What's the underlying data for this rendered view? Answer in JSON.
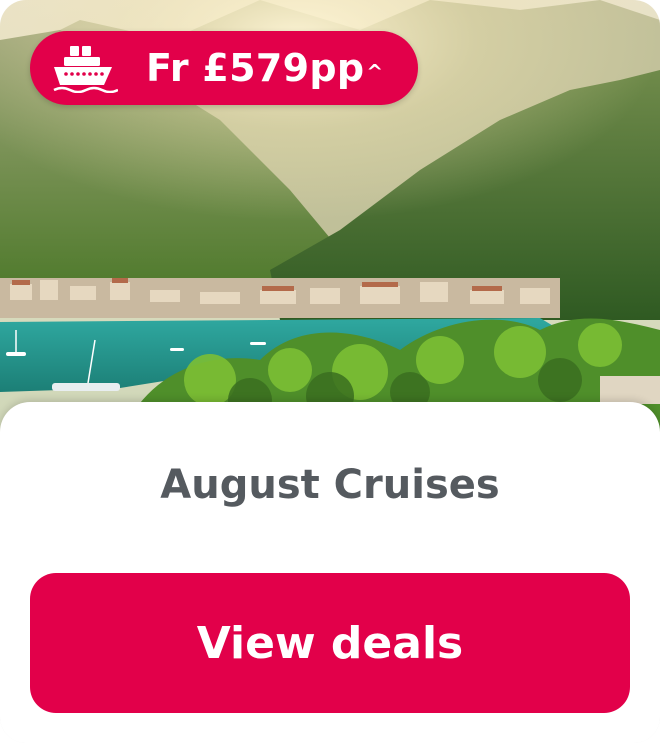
{
  "badge": {
    "price_text": "Fr £579pp",
    "price_suffix": "^",
    "icon": "ship-icon"
  },
  "card": {
    "title": "August Cruises",
    "cta_label": "View deals"
  },
  "colors": {
    "brand": "#e2004a",
    "title_text": "#555a5f",
    "panel_bg": "#ffffff"
  }
}
